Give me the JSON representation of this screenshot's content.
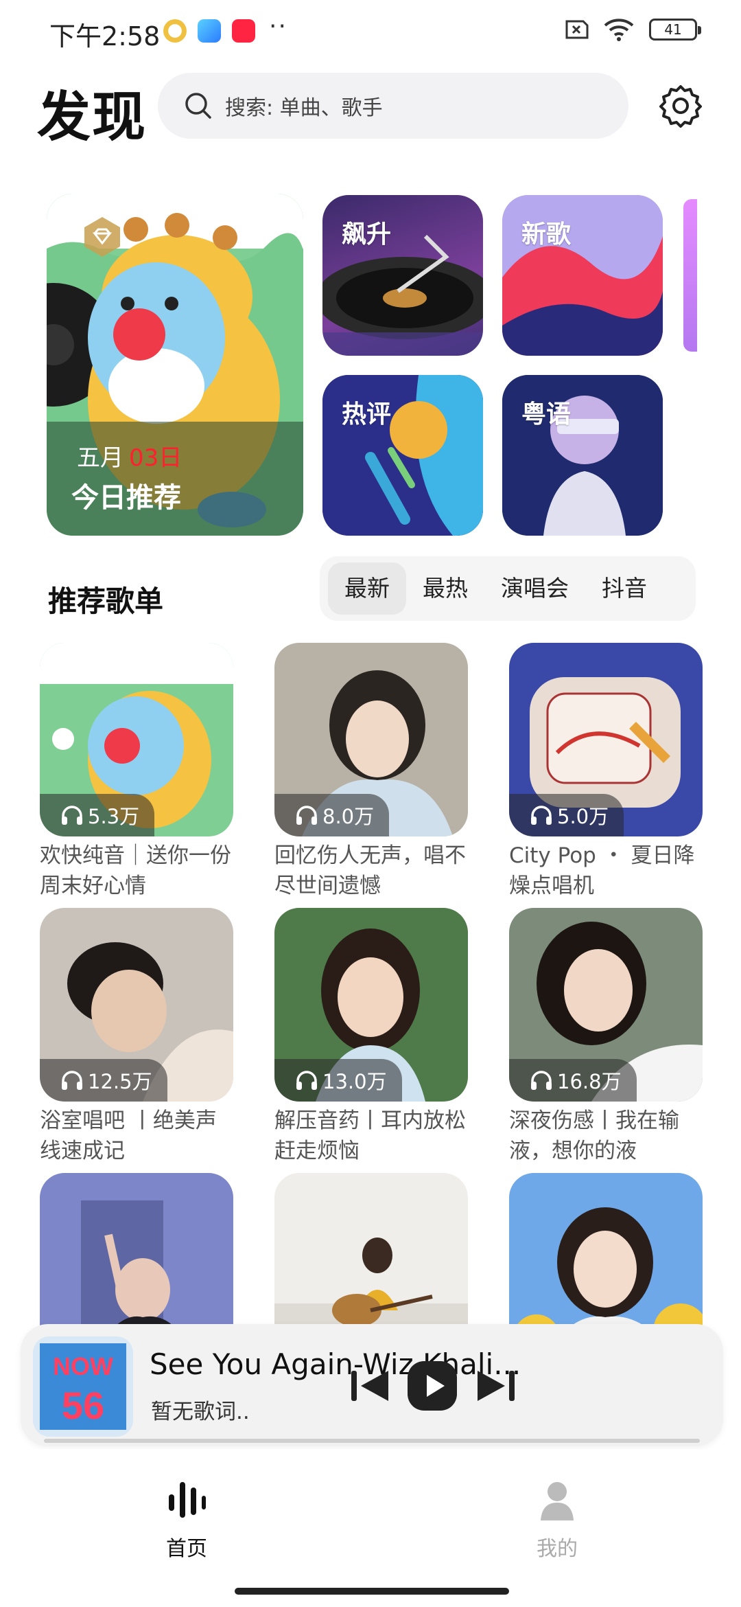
{
  "status_bar": {
    "time": "下午2:58",
    "battery": "41"
  },
  "header": {
    "title": "发现",
    "search_placeholder": "搜索: 单曲、歌手"
  },
  "featured": {
    "month": "五月",
    "day": "03日",
    "title": "今日推荐"
  },
  "tiles": [
    {
      "label": "飙升"
    },
    {
      "label": "新歌"
    },
    {
      "label": "热评"
    },
    {
      "label": "粤语"
    }
  ],
  "section": {
    "title": "推荐歌单",
    "tabs": [
      "最新",
      "最热",
      "演唱会",
      "抖音"
    ],
    "active_tab": "最新"
  },
  "playlists": [
    {
      "plays": "5.3万",
      "title": "欢快纯音｜送你一份周末好心情"
    },
    {
      "plays": "8.0万",
      "title": "回忆伤人无声，唱不尽世间遗憾"
    },
    {
      "plays": "5.0万",
      "title": "City Pop ・ 夏日降燥点唱机"
    },
    {
      "plays": "12.5万",
      "title": "浴室唱吧 丨绝美声线速成记"
    },
    {
      "plays": "13.0万",
      "title": "解压音药丨耳内放松赶走烦恼"
    },
    {
      "plays": "16.8万",
      "title": "深夜伤感丨我在输液，想你的液"
    },
    {
      "plays": "",
      "title": ""
    },
    {
      "plays": "",
      "title": ""
    },
    {
      "plays": "",
      "title": ""
    }
  ],
  "player": {
    "title": "See You Again-Wiz Khali...",
    "subtitle": "暂无歌词..",
    "album_text": "NOW",
    "album_number": "56"
  },
  "nav": {
    "home": "首页",
    "mine": "我的"
  },
  "colors": {
    "accent": "#111111",
    "inactive": "#aaaaaa",
    "date_red": "#ff1f2e"
  }
}
